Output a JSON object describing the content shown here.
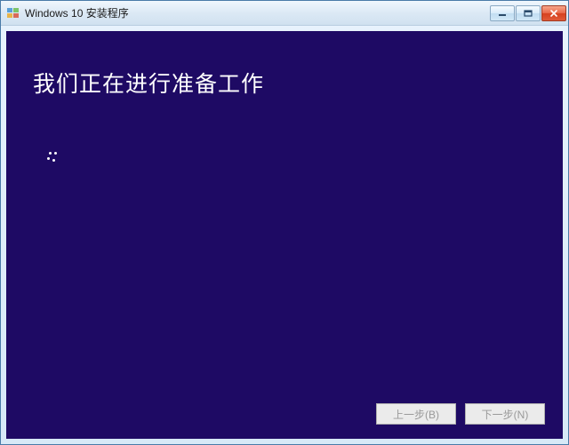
{
  "window": {
    "title": "Windows 10 安装程序"
  },
  "main": {
    "heading": "我们正在进行准备工作"
  },
  "buttons": {
    "back": "上一步(B)",
    "next": "下一步(N)"
  }
}
